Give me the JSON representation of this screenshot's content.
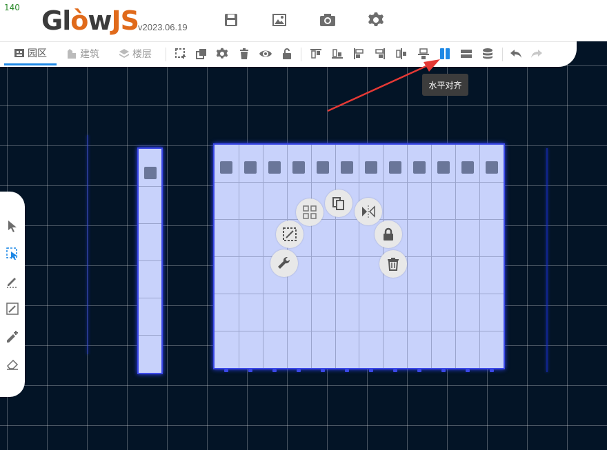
{
  "fps": "140",
  "app": {
    "logo_part1": "Gl",
    "logo_part2": "w",
    "logo_part3": "JS",
    "version": "v2023.06.19"
  },
  "header_buttons": [
    "save-icon",
    "image-icon",
    "camera-icon",
    "gear-icon"
  ],
  "tabs": [
    {
      "label": "园区",
      "icon": "park-icon",
      "active": true
    },
    {
      "label": "建筑",
      "icon": "building-icon",
      "active": false
    },
    {
      "label": "楼层",
      "icon": "layers-icon",
      "active": false
    }
  ],
  "toolbar_icons": [
    "add-icon",
    "copy-icon",
    "gear-icon",
    "delete-icon",
    "eye-icon",
    "unlock-icon",
    "align-top-icon",
    "align-bottom-icon",
    "align-left-icon",
    "align-right-icon",
    "align-center-h-icon",
    "align-center-v-icon",
    "horizontal-align-icon",
    "vertical-align-icon",
    "database-icon",
    "undo-icon",
    "redo-icon"
  ],
  "tooltip": "水平对齐",
  "left_tools": [
    "pointer-icon",
    "select-icon",
    "pen-icon",
    "edit-box-icon",
    "add-pen-icon",
    "eraser-icon"
  ],
  "context_menu": [
    "wrench-icon",
    "edit-select-icon",
    "grid-icon",
    "copy-icon",
    "mirror-icon",
    "lock-icon",
    "trash-icon"
  ],
  "colors": {
    "accent": "#1e88e5",
    "rack_fill": "#c8d2fb",
    "rack_border": "#3a48e6",
    "background": "#031426",
    "arrow": "#e53935"
  }
}
